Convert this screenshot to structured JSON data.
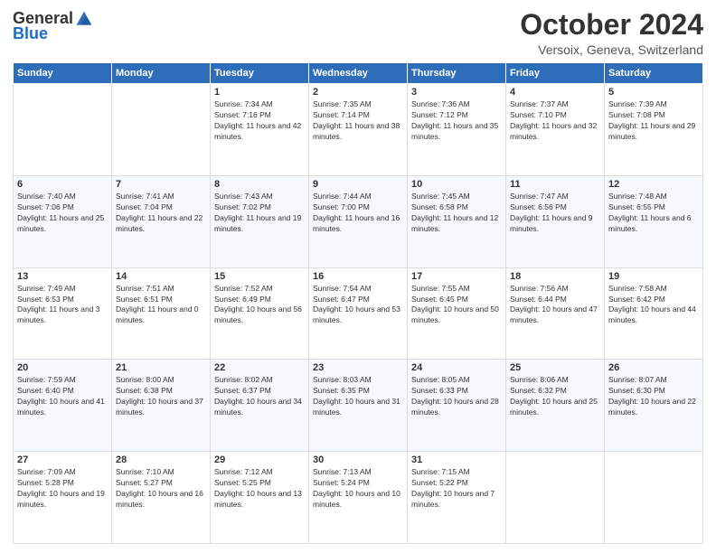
{
  "header": {
    "logo_general": "General",
    "logo_blue": "Blue",
    "month_title": "October 2024",
    "location": "Versoix, Geneva, Switzerland"
  },
  "days_of_week": [
    "Sunday",
    "Monday",
    "Tuesday",
    "Wednesday",
    "Thursday",
    "Friday",
    "Saturday"
  ],
  "weeks": [
    [
      {
        "day": "",
        "sunrise": "",
        "sunset": "",
        "daylight": ""
      },
      {
        "day": "",
        "sunrise": "",
        "sunset": "",
        "daylight": ""
      },
      {
        "day": "1",
        "sunrise": "Sunrise: 7:34 AM",
        "sunset": "Sunset: 7:16 PM",
        "daylight": "Daylight: 11 hours and 42 minutes."
      },
      {
        "day": "2",
        "sunrise": "Sunrise: 7:35 AM",
        "sunset": "Sunset: 7:14 PM",
        "daylight": "Daylight: 11 hours and 38 minutes."
      },
      {
        "day": "3",
        "sunrise": "Sunrise: 7:36 AM",
        "sunset": "Sunset: 7:12 PM",
        "daylight": "Daylight: 11 hours and 35 minutes."
      },
      {
        "day": "4",
        "sunrise": "Sunrise: 7:37 AM",
        "sunset": "Sunset: 7:10 PM",
        "daylight": "Daylight: 11 hours and 32 minutes."
      },
      {
        "day": "5",
        "sunrise": "Sunrise: 7:39 AM",
        "sunset": "Sunset: 7:08 PM",
        "daylight": "Daylight: 11 hours and 29 minutes."
      }
    ],
    [
      {
        "day": "6",
        "sunrise": "Sunrise: 7:40 AM",
        "sunset": "Sunset: 7:06 PM",
        "daylight": "Daylight: 11 hours and 25 minutes."
      },
      {
        "day": "7",
        "sunrise": "Sunrise: 7:41 AM",
        "sunset": "Sunset: 7:04 PM",
        "daylight": "Daylight: 11 hours and 22 minutes."
      },
      {
        "day": "8",
        "sunrise": "Sunrise: 7:43 AM",
        "sunset": "Sunset: 7:02 PM",
        "daylight": "Daylight: 11 hours and 19 minutes."
      },
      {
        "day": "9",
        "sunrise": "Sunrise: 7:44 AM",
        "sunset": "Sunset: 7:00 PM",
        "daylight": "Daylight: 11 hours and 16 minutes."
      },
      {
        "day": "10",
        "sunrise": "Sunrise: 7:45 AM",
        "sunset": "Sunset: 6:58 PM",
        "daylight": "Daylight: 11 hours and 12 minutes."
      },
      {
        "day": "11",
        "sunrise": "Sunrise: 7:47 AM",
        "sunset": "Sunset: 6:56 PM",
        "daylight": "Daylight: 11 hours and 9 minutes."
      },
      {
        "day": "12",
        "sunrise": "Sunrise: 7:48 AM",
        "sunset": "Sunset: 6:55 PM",
        "daylight": "Daylight: 11 hours and 6 minutes."
      }
    ],
    [
      {
        "day": "13",
        "sunrise": "Sunrise: 7:49 AM",
        "sunset": "Sunset: 6:53 PM",
        "daylight": "Daylight: 11 hours and 3 minutes."
      },
      {
        "day": "14",
        "sunrise": "Sunrise: 7:51 AM",
        "sunset": "Sunset: 6:51 PM",
        "daylight": "Daylight: 11 hours and 0 minutes."
      },
      {
        "day": "15",
        "sunrise": "Sunrise: 7:52 AM",
        "sunset": "Sunset: 6:49 PM",
        "daylight": "Daylight: 10 hours and 56 minutes."
      },
      {
        "day": "16",
        "sunrise": "Sunrise: 7:54 AM",
        "sunset": "Sunset: 6:47 PM",
        "daylight": "Daylight: 10 hours and 53 minutes."
      },
      {
        "day": "17",
        "sunrise": "Sunrise: 7:55 AM",
        "sunset": "Sunset: 6:45 PM",
        "daylight": "Daylight: 10 hours and 50 minutes."
      },
      {
        "day": "18",
        "sunrise": "Sunrise: 7:56 AM",
        "sunset": "Sunset: 6:44 PM",
        "daylight": "Daylight: 10 hours and 47 minutes."
      },
      {
        "day": "19",
        "sunrise": "Sunrise: 7:58 AM",
        "sunset": "Sunset: 6:42 PM",
        "daylight": "Daylight: 10 hours and 44 minutes."
      }
    ],
    [
      {
        "day": "20",
        "sunrise": "Sunrise: 7:59 AM",
        "sunset": "Sunset: 6:40 PM",
        "daylight": "Daylight: 10 hours and 41 minutes."
      },
      {
        "day": "21",
        "sunrise": "Sunrise: 8:00 AM",
        "sunset": "Sunset: 6:38 PM",
        "daylight": "Daylight: 10 hours and 37 minutes."
      },
      {
        "day": "22",
        "sunrise": "Sunrise: 8:02 AM",
        "sunset": "Sunset: 6:37 PM",
        "daylight": "Daylight: 10 hours and 34 minutes."
      },
      {
        "day": "23",
        "sunrise": "Sunrise: 8:03 AM",
        "sunset": "Sunset: 6:35 PM",
        "daylight": "Daylight: 10 hours and 31 minutes."
      },
      {
        "day": "24",
        "sunrise": "Sunrise: 8:05 AM",
        "sunset": "Sunset: 6:33 PM",
        "daylight": "Daylight: 10 hours and 28 minutes."
      },
      {
        "day": "25",
        "sunrise": "Sunrise: 8:06 AM",
        "sunset": "Sunset: 6:32 PM",
        "daylight": "Daylight: 10 hours and 25 minutes."
      },
      {
        "day": "26",
        "sunrise": "Sunrise: 8:07 AM",
        "sunset": "Sunset: 6:30 PM",
        "daylight": "Daylight: 10 hours and 22 minutes."
      }
    ],
    [
      {
        "day": "27",
        "sunrise": "Sunrise: 7:09 AM",
        "sunset": "Sunset: 5:28 PM",
        "daylight": "Daylight: 10 hours and 19 minutes."
      },
      {
        "day": "28",
        "sunrise": "Sunrise: 7:10 AM",
        "sunset": "Sunset: 5:27 PM",
        "daylight": "Daylight: 10 hours and 16 minutes."
      },
      {
        "day": "29",
        "sunrise": "Sunrise: 7:12 AM",
        "sunset": "Sunset: 5:25 PM",
        "daylight": "Daylight: 10 hours and 13 minutes."
      },
      {
        "day": "30",
        "sunrise": "Sunrise: 7:13 AM",
        "sunset": "Sunset: 5:24 PM",
        "daylight": "Daylight: 10 hours and 10 minutes."
      },
      {
        "day": "31",
        "sunrise": "Sunrise: 7:15 AM",
        "sunset": "Sunset: 5:22 PM",
        "daylight": "Daylight: 10 hours and 7 minutes."
      },
      {
        "day": "",
        "sunrise": "",
        "sunset": "",
        "daylight": ""
      },
      {
        "day": "",
        "sunrise": "",
        "sunset": "",
        "daylight": ""
      }
    ]
  ]
}
